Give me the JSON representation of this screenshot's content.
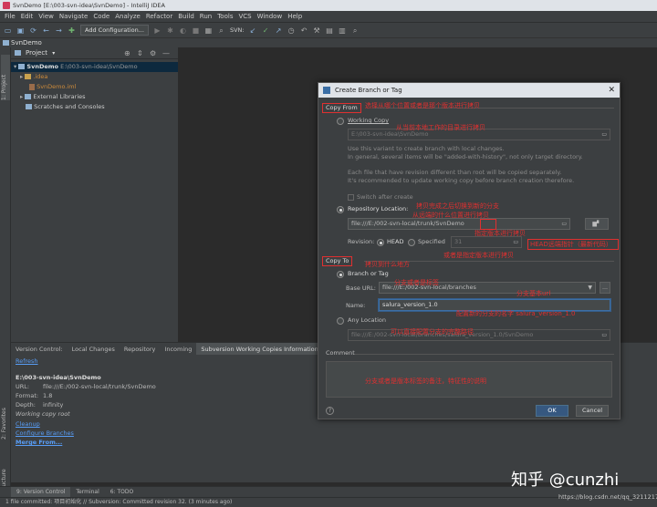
{
  "window": {
    "title": "SvnDemo [E:\\003-svn-idea\\SvnDemo] - IntelliJ IDEA"
  },
  "menu": [
    "File",
    "Edit",
    "View",
    "Navigate",
    "Code",
    "Analyze",
    "Refactor",
    "Build",
    "Run",
    "Tools",
    "VCS",
    "Window",
    "Help"
  ],
  "toolbar": {
    "add_config": "Add Configuration...",
    "svn_label": "SVN:"
  },
  "navbar": {
    "project": "SvnDemo"
  },
  "project_panel": {
    "header": "Project",
    "tree": [
      {
        "label": "SvnDemo",
        "path": "E:\\003-svn-idea\\SvnDemo"
      },
      {
        "label": ".idea"
      },
      {
        "label": "SvnDemo.iml"
      },
      {
        "label": "External Libraries"
      },
      {
        "label": "Scratches and Consoles"
      }
    ],
    "side_tabs": {
      "project": "1: Project",
      "favorites": "2: Favorites",
      "structure": "7: Structure"
    }
  },
  "bottom_tabs": [
    "Version Control:",
    "Local Changes",
    "Repository",
    "Incoming",
    "Subversion Working Copies Information"
  ],
  "vc_info": {
    "refresh": "Refresh",
    "root": "E:\\003-svn-idea\\SvnDemo",
    "url_label": "URL:",
    "url": "file:///E:/002-svn-local/trunk/SvnDemo",
    "format_label": "Format:",
    "format": "1.8",
    "depth_label": "Depth:",
    "depth": "infinity",
    "working_copy_root": "Working copy root",
    "cleanup": "Cleanup",
    "configure_branches": "Configure Branches",
    "merge_from": "Merge From..."
  },
  "status_tabs": [
    "9: Version Control",
    "Terminal",
    "6: TODO"
  ],
  "statusbar": "1 file committed: 项目初始化 // Subversion: Committed revision 32. (3 minutes ago)",
  "dialog": {
    "title": "Create Branch or Tag",
    "copy_from": "Copy From",
    "working_copy": "Working Copy",
    "working_copy_path": "E:\\003-svn-idea\\SvnDemo",
    "wc_desc_1": "Use this variant to create branch with local changes.",
    "wc_desc_2": "In general, several items will be \"added-with-history\", not only target directory.",
    "wc_desc_3": "Each file that have revision different than root will be copied separately.",
    "wc_desc_4": "It's recommended to update working copy before branch creation therefore.",
    "switch_after": "Switch after create",
    "repo_location": "Repository Location:",
    "repo_url": "file:///E:/002-svn-local/trunk/SvnDemo",
    "revision_label": "Revision:",
    "head": "HEAD",
    "specified": "Specified",
    "revision_value": "31",
    "copy_to": "Copy To",
    "branch_or_tag": "Branch or Tag",
    "base_url_label": "Base URL:",
    "base_url": "file:///E:/002-svn-local/branches",
    "name_label": "Name:",
    "name_value": "salura_version_1.0",
    "any_location": "Any Location",
    "any_location_url": "file:///E:/002-svn-local/branches/salura_version_1.0/SvnDemo",
    "comment_label": "Comment",
    "ok": "OK",
    "cancel": "Cancel"
  },
  "annotations": {
    "a1": "选择从哪个位置或者是那个版本进行拷贝",
    "a2": "从当前本地工作的目录进行拷贝",
    "a3": "拷贝完成之后切换到新的分支",
    "a4": "从远端的什么位置进行拷贝",
    "a5": "指定版本进行拷贝",
    "a6": "或者是指定版本进行拷贝",
    "a7": "拷贝到什么地方",
    "a8": "分支或者是标签",
    "a9": "分支基本url",
    "a10": "配置新的分支的名字 salura_version_1.0",
    "a11": "可以直接配置分支的完整路径",
    "a12": "分支或者是版本标签的备注，特征性的说明",
    "a13": "HEAD远端指针（最新代码）"
  },
  "watermark": {
    "brand": "知乎 @cunzhi",
    "url": "https://blog.csdn.net/qq_32112175"
  }
}
